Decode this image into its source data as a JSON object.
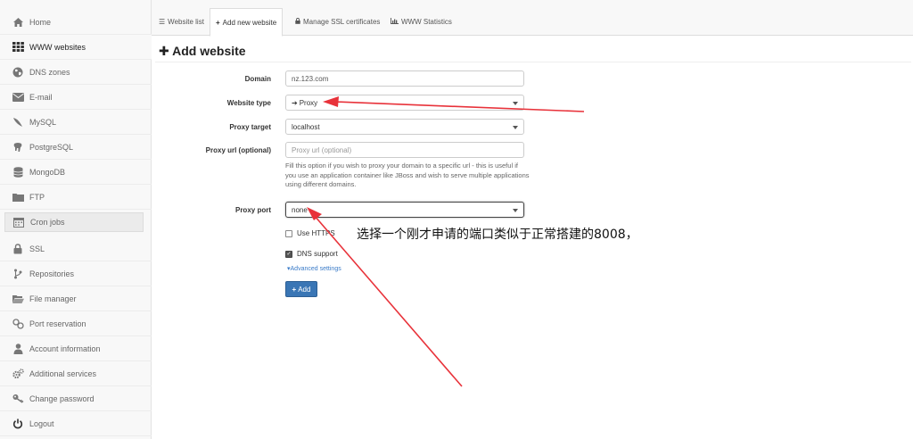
{
  "sidebar": {
    "items": [
      {
        "label": "Home",
        "icon": "home-icon"
      },
      {
        "label": "WWW websites",
        "icon": "grid-icon"
      },
      {
        "label": "DNS zones",
        "icon": "globe-icon"
      },
      {
        "label": "E-mail",
        "icon": "envelope-icon"
      },
      {
        "label": "MySQL",
        "icon": "dolphin-icon"
      },
      {
        "label": "PostgreSQL",
        "icon": "elephant-icon"
      },
      {
        "label": "MongoDB",
        "icon": "database-icon"
      },
      {
        "label": "FTP",
        "icon": "folder-icon"
      },
      {
        "label": "Cron jobs",
        "icon": "calendar-icon"
      },
      {
        "label": "SSL",
        "icon": "lock-icon"
      },
      {
        "label": "Repositories",
        "icon": "branch-icon"
      },
      {
        "label": "File manager",
        "icon": "folder-open-icon"
      },
      {
        "label": "Port reservation",
        "icon": "plug-icon"
      },
      {
        "label": "Account information",
        "icon": "user-icon"
      },
      {
        "label": "Additional services",
        "icon": "cogs-icon"
      },
      {
        "label": "Change password",
        "icon": "key-icon"
      },
      {
        "label": "Logout",
        "icon": "power-icon"
      }
    ]
  },
  "tabs": [
    {
      "label": "Website list",
      "icon": "list-icon"
    },
    {
      "label": "Add new website",
      "icon": "plus-icon"
    },
    {
      "label": "Manage SSL certificates",
      "icon": "lock-icon"
    },
    {
      "label": "WWW Statistics",
      "icon": "chart-icon"
    }
  ],
  "page": {
    "title": "Add website"
  },
  "form": {
    "domain": {
      "label": "Domain",
      "value": "nz.123.com"
    },
    "website_type": {
      "label": "Website type",
      "value": "Proxy"
    },
    "proxy_target": {
      "label": "Proxy target",
      "value": "localhost"
    },
    "proxy_url": {
      "label": "Proxy url (optional)",
      "placeholder": "Proxy url (optional)",
      "help": "Fill this option if you wish to proxy your domain to a specific url - this is useful if you use an application container like JBoss and wish to serve multiple applications using different domains."
    },
    "proxy_port": {
      "label": "Proxy port",
      "value": "none"
    },
    "use_https": {
      "label": "Use HTTPS",
      "checked": false
    },
    "dns_support": {
      "label": "DNS support",
      "checked": true
    },
    "advanced_settings": "Advanced settings",
    "add_button": "Add"
  },
  "annotation": {
    "text": "选择一个刚才申请的端口类似于正常搭建的8008，"
  },
  "colors": {
    "arrow": "#e8323a",
    "primary_button": "#3a76b5",
    "link": "#3a7bc8"
  }
}
